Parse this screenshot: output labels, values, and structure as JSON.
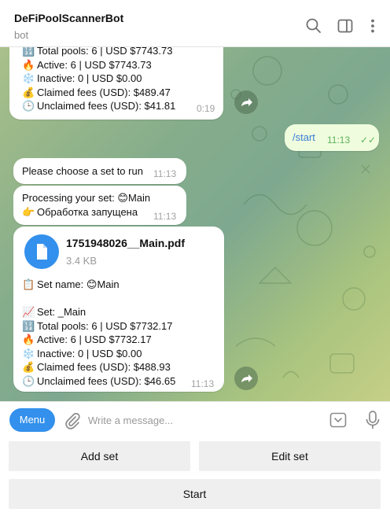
{
  "header": {
    "title": "DeFiPoolScannerBot",
    "subtitle": "bot",
    "icons": [
      "search-icon",
      "sidebar-toggle-icon",
      "more-vertical-icon"
    ]
  },
  "messages": {
    "m1": {
      "lines": [
        {
          "emoji": "🔢",
          "text": "Total pools: 6 | USD $7743.73"
        },
        {
          "emoji": "🔥",
          "text": "Active: 6 | USD $7743.73"
        },
        {
          "emoji": "❄️",
          "text": "Inactive: 0 | USD $0.00"
        },
        {
          "emoji": "💰",
          "text": "Claimed fees (USD): $489.47"
        },
        {
          "emoji": "🕒",
          "text": "Unclaimed fees (USD): $41.81"
        }
      ],
      "time": "0:19"
    },
    "m2": {
      "text": "/start",
      "time": "11:13",
      "status": "✓✓"
    },
    "m3": {
      "text": "Please choose a set to run",
      "time": "11:13"
    },
    "m4": {
      "line1": "Processing your set: ",
      "line1_emoji": "😊",
      "line1_tail": "Main",
      "line2_emoji": "👉",
      "line2": "Обработка запущена",
      "time": "11:13"
    },
    "m5": {
      "file_name": "1751948026__Main.pdf",
      "file_size": "3.4 KB",
      "set_name_emoji": "📋",
      "set_name_label": "Set name: ",
      "set_name_face": "😊",
      "set_name_value": "Main",
      "set_emoji": "📈",
      "set_label": "Set: _Main",
      "lines": [
        {
          "emoji": "🔢",
          "text": "Total pools: 6 | USD $7732.17"
        },
        {
          "emoji": "🔥",
          "text": "Active: 6 | USD $7732.17"
        },
        {
          "emoji": "❄️",
          "text": "Inactive: 0 | USD $0.00"
        },
        {
          "emoji": "💰",
          "text": "Claimed fees (USD): $488.93"
        },
        {
          "emoji": "🕒",
          "text": "Unclaimed fees (USD): $46.65"
        }
      ],
      "time": "11:13"
    }
  },
  "composer": {
    "menu_label": "Menu",
    "placeholder": "Write a message..."
  },
  "keyboard": {
    "add_set": "Add set",
    "edit_set": "Edit set",
    "start": "Start"
  },
  "colors": {
    "accent": "#3390ec",
    "outgoing_bubble": "#effdde",
    "read_check": "#5fb35b"
  }
}
